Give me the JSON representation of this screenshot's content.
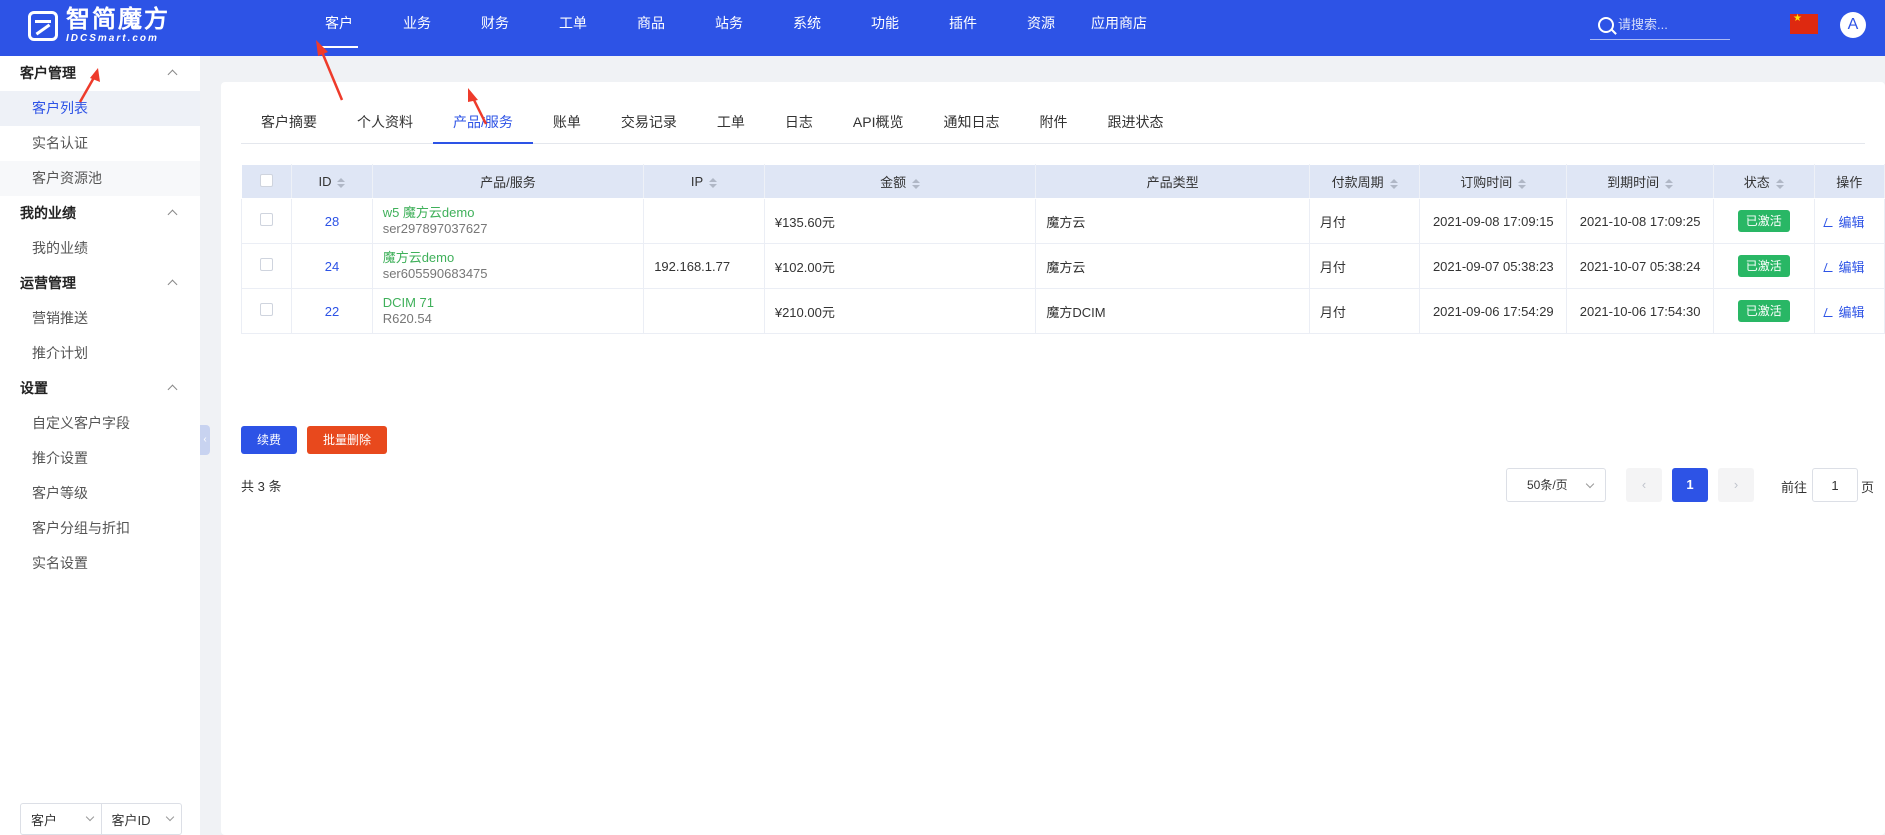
{
  "brand": {
    "name": "智简魔方",
    "sub": "IDCSmart.com"
  },
  "topnav": [
    "客户",
    "业务",
    "财务",
    "工单",
    "商品",
    "站务",
    "系统",
    "功能",
    "插件",
    "资源",
    "应用商店"
  ],
  "search": {
    "placeholder": "请搜索..."
  },
  "avatar": "A",
  "sidebar": {
    "groups": [
      {
        "title": "客户管理",
        "items": [
          "客户列表",
          "实名认证",
          "客户资源池"
        ]
      },
      {
        "title": "我的业绩",
        "items": [
          "我的业绩"
        ]
      },
      {
        "title": "运营管理",
        "items": [
          "营销推送",
          "推介计划"
        ]
      },
      {
        "title": "设置",
        "items": [
          "自定义客户字段",
          "推介设置",
          "客户等级",
          "客户分组与折扣",
          "实名设置"
        ]
      }
    ],
    "footer": {
      "select1": "客户",
      "select2": "客户ID"
    }
  },
  "tabs": [
    "客户摘要",
    "个人资料",
    "产品/服务",
    "账单",
    "交易记录",
    "工单",
    "日志",
    "API概览",
    "通知日志",
    "附件",
    "跟进状态"
  ],
  "table": {
    "headers": {
      "id": "ID",
      "product": "产品/服务",
      "ip": "IP",
      "amount": "金额",
      "type": "产品类型",
      "cycle": "付款周期",
      "order_time": "订购时间",
      "expire_time": "到期时间",
      "status": "状态",
      "action": "操作"
    },
    "rows": [
      {
        "id": "28",
        "name": "w5 魔方云demo",
        "sub": "ser297897037627",
        "ip": "",
        "amount": "¥135.60元",
        "type": "魔方云",
        "cycle": "月付",
        "order_time": "2021-09-08 17:09:15",
        "expire_time": "2021-10-08 17:09:25",
        "status": "已激活",
        "action": "编辑"
      },
      {
        "id": "24",
        "name": "魔方云demo",
        "sub": "ser605590683475",
        "ip": "192.168.1.77",
        "amount": "¥102.00元",
        "type": "魔方云",
        "cycle": "月付",
        "order_time": "2021-09-07 05:38:23",
        "expire_time": "2021-10-07 05:38:24",
        "status": "已激活",
        "action": "编辑"
      },
      {
        "id": "22",
        "name": "DCIM 71",
        "sub": "R620.54",
        "ip": "",
        "amount": "¥210.00元",
        "type": "魔方DCIM",
        "cycle": "月付",
        "order_time": "2021-09-06 17:54:29",
        "expire_time": "2021-10-06 17:54:30",
        "status": "已激活",
        "action": "编辑"
      }
    ]
  },
  "buttons": {
    "renew": "续费",
    "delete": "批量删除"
  },
  "total": "共 3 条",
  "pager": {
    "size": "50条/页",
    "current": "1",
    "jump_label": "前往",
    "jump_value": "1",
    "jump_suffix": "页"
  },
  "colors": {
    "primary": "#2d53e6",
    "success": "#29b765",
    "danger": "#e8491d",
    "product_link": "#3fb05a"
  }
}
